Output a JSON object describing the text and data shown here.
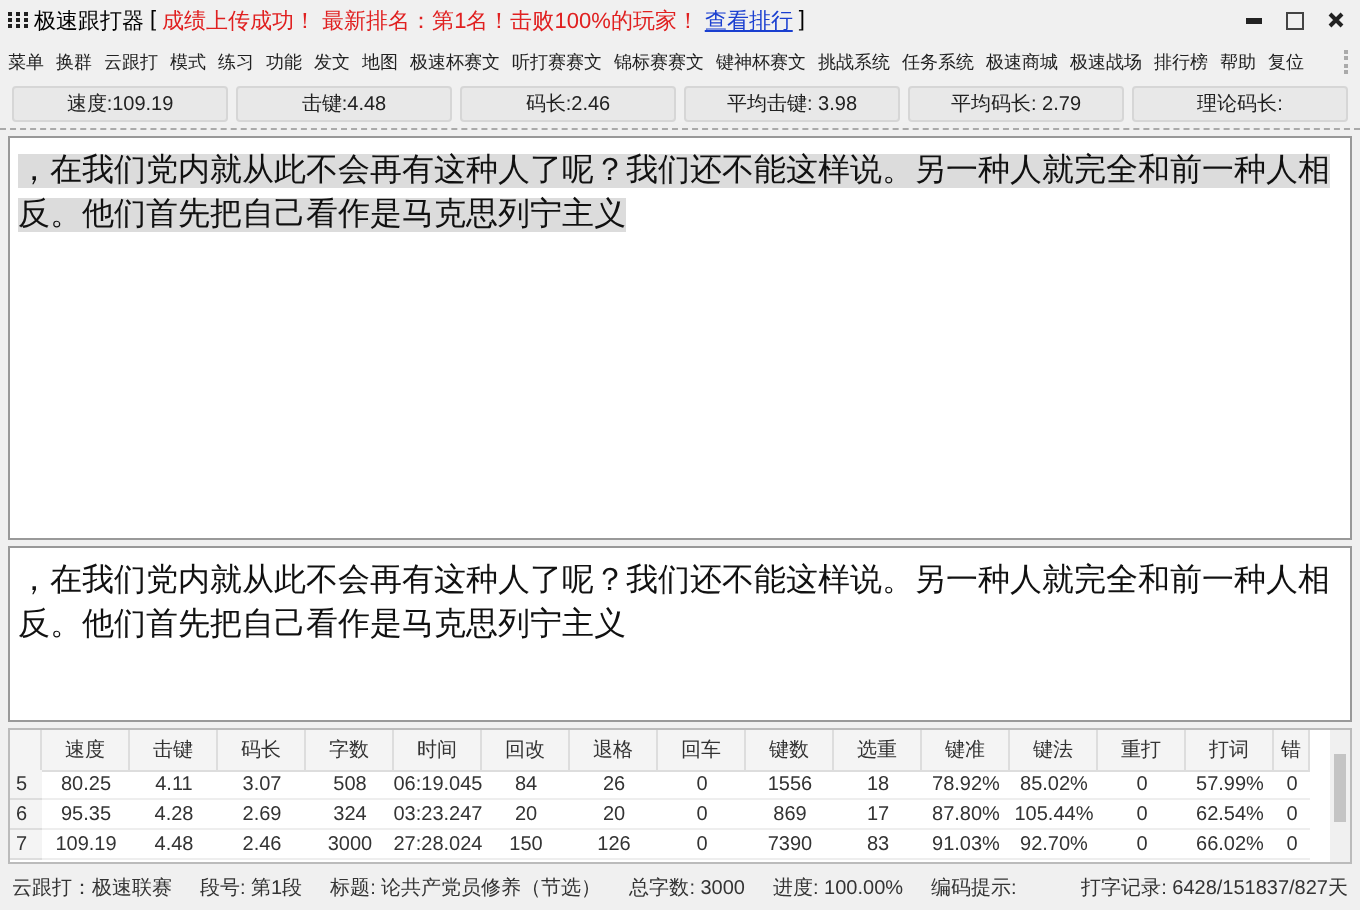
{
  "window": {
    "title": "极速跟打器",
    "bracket_open": "[",
    "message": "成绩上传成功！ 最新排名：第1名！击败100%的玩家！",
    "link": "查看排行",
    "bracket_close": "]"
  },
  "menu": [
    "菜单",
    "换群",
    "云跟打",
    "模式",
    "练习",
    "功能",
    "发文",
    "地图",
    "极速杯赛文",
    "听打赛赛文",
    "锦标赛赛文",
    "键神杯赛文",
    "挑战系统",
    "任务系统",
    "极速商城",
    "极速战场",
    "排行榜",
    "帮助",
    "复位"
  ],
  "stats": [
    "速度:109.19",
    "击键:4.48",
    "码长:2.46",
    "平均击键: 3.98",
    "平均码长: 2.79",
    "理论码长:"
  ],
  "source_text": "，在我们党内就从此不会再有这种人了呢？我们还不能这样说。另一种人就完全和前一种人相反。他们首先把自己看作是马克思列宁主义",
  "typed_text": "，在我们党内就从此不会再有这种人了呢？我们还不能这样说。另一种人就完全和前一种人相反。他们首先把自己看作是马克思列宁主义",
  "table": {
    "columns": [
      "速度",
      "击键",
      "码长",
      "字数",
      "时间",
      "回改",
      "退格",
      "回车",
      "键数",
      "选重",
      "键准",
      "键法",
      "重打",
      "打词",
      "错"
    ],
    "rows": [
      {
        "index": "5",
        "cells": [
          "80.25",
          "4.11",
          "3.07",
          "508",
          "06:19.045",
          "84",
          "26",
          "0",
          "1556",
          "18",
          "78.92%",
          "85.02%",
          "0",
          "57.99%",
          "0"
        ]
      },
      {
        "index": "6",
        "cells": [
          "95.35",
          "4.28",
          "2.69",
          "324",
          "03:23.247",
          "20",
          "20",
          "0",
          "869",
          "17",
          "87.80%",
          "105.44%",
          "0",
          "62.54%",
          "0"
        ]
      },
      {
        "index": "7",
        "cells": [
          "109.19",
          "4.48",
          "2.46",
          "3000",
          "27:28.024",
          "150",
          "126",
          "0",
          "7390",
          "83",
          "91.03%",
          "92.70%",
          "0",
          "66.02%",
          "0"
        ]
      }
    ]
  },
  "status_bar": [
    "云跟打：极速联赛",
    "段号: 第1段",
    "标题: 论共产党员修养（节选）",
    "总字数: 3000",
    "进度: 100.00%",
    "编码提示:",
    "打字记录: 6428/151837/827天"
  ]
}
